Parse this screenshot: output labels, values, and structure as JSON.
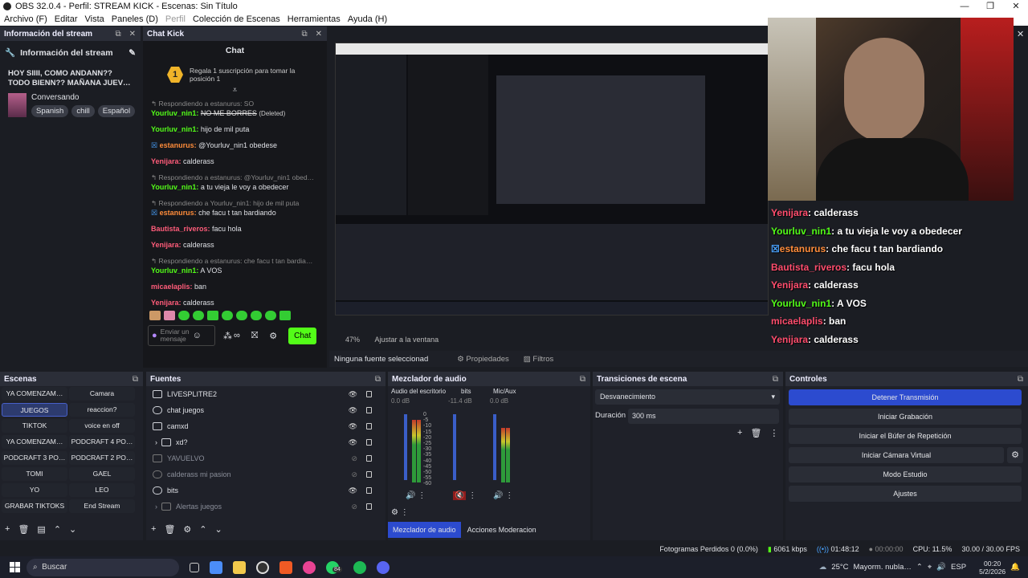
{
  "window": {
    "title": "OBS 32.0.4 - Perfil: STREAM KICK - Escenas: Sin Título"
  },
  "menu": [
    "Archivo (F)",
    "Editar",
    "Vista",
    "Paneles (D)",
    "Perfil",
    "Colección de Escenas",
    "Herramientas",
    "Ayuda (H)"
  ],
  "info_dock": {
    "header": "Información del stream",
    "title": "Información del stream",
    "stream_title": "HOY SIIII, COMO ANDANN?? TODO BIENN?? MAÑANA JUEV…",
    "category": "Conversando",
    "tags": [
      "Spanish",
      "chill",
      "Español"
    ]
  },
  "chat_dock": {
    "header": "Chat Kick",
    "title": "Chat",
    "gift_text": "Regala 1 suscripción para tomar la posición 1",
    "gift_rank": "1",
    "input_placeholder": "Enviar un mensaje",
    "send_label": "Chat",
    "messages": [
      {
        "reply": "Respondiendo a estanurus: SO"
      },
      {
        "user": "Yourluv_nin1:",
        "text": "NO ME BORRES",
        "note": "(Deleted)",
        "color": "green"
      },
      {
        "user": "Yourluv_nin1:",
        "text": "hijo de mil puta",
        "color": "green"
      },
      {
        "user": "estanurus:",
        "text": "@Yourluv_nin1 obedese",
        "color": "orange"
      },
      {
        "user": "Yenijara:",
        "text": "calderass",
        "color": "red"
      },
      {
        "reply": "Respondiendo a estanurus: @Yourluv_nin1 obed…"
      },
      {
        "user": "Yourluv_nin1:",
        "text": "a tu vieja le voy a obedecer",
        "color": "green"
      },
      {
        "reply": "Respondiendo a Yourluv_nin1: hijo de mil puta"
      },
      {
        "user": "estanurus:",
        "text": "che facu t tan bardiando",
        "color": "orange"
      },
      {
        "user": "Bautista_riveros:",
        "text": "facu hola",
        "color": "red"
      },
      {
        "user": "Yenijara:",
        "text": "calderass",
        "color": "red"
      },
      {
        "reply": "Respondiendo a estanurus: che facu t tan bardia…"
      },
      {
        "user": "Yourluv_nin1:",
        "text": "A VOS",
        "color": "green"
      },
      {
        "user": "micaelaplis:",
        "text": "ban",
        "color": "red"
      },
      {
        "user": "Yenijara:",
        "text": "calderass",
        "color": "red"
      }
    ]
  },
  "preview": {
    "zoom": "47%",
    "fit": "Ajustar a la ventana",
    "no_source": "Ninguna fuente seleccionad",
    "properties": "Propiedades",
    "filters": "Filtros"
  },
  "overlay_chat": [
    {
      "user": "Yenijara",
      "text": ": calderass",
      "color": "#ff4d6d"
    },
    {
      "user": "Yourluv_nin1",
      "text": ": a tu vieja le voy a obedecer",
      "color": "#53fc18"
    },
    {
      "user": "estanurus",
      "text": ": che facu t tan bardiando",
      "color": "#ff8c3a"
    },
    {
      "user": "Bautista_riveros",
      "text": ": facu hola",
      "color": "#ff4d6d"
    },
    {
      "user": "Yenijara",
      "text": ": calderass",
      "color": "#ff4d6d"
    },
    {
      "user": "Yourluv_nin1",
      "text": ": A VOS",
      "color": "#53fc18"
    },
    {
      "user": "micaelaplis",
      "text": ": ban",
      "color": "#ff4d6d"
    },
    {
      "user": "Yenijara",
      "text": ": calderass",
      "color": "#ff4d6d"
    }
  ],
  "scenes": {
    "header": "Escenas",
    "items": [
      "YA COMENZAM…",
      "Camara",
      "JUEGOS",
      "reaccion?",
      "TIKTOK",
      "voice en off",
      "YA COMENZAM…",
      "PODCRAFT 4 PO…",
      "PODCRAFT 3 PO…",
      "PODCRAFT 2 PO…",
      "TOMI",
      "GAEL",
      "YO",
      "LEO",
      "GRABAR TIKTOKS",
      "End Stream"
    ],
    "selected": "JUEGOS"
  },
  "sources": {
    "header": "Fuentes",
    "items": [
      {
        "name": "LIVESPLITRE2",
        "visible": true
      },
      {
        "name": "chat juegos",
        "visible": true
      },
      {
        "name": "camxd",
        "visible": true
      },
      {
        "name": "xd?",
        "visible": true,
        "group": true
      },
      {
        "name": "YAVUELVO",
        "visible": false
      },
      {
        "name": "calderass mi pasion",
        "visible": false
      },
      {
        "name": "bits",
        "visible": true
      },
      {
        "name": "Alertas juegos",
        "visible": false,
        "group": true
      }
    ]
  },
  "mixer": {
    "header": "Mezclador de audio",
    "channels": [
      {
        "name": "Audio del escritorio",
        "db": "0.0 dB"
      },
      {
        "name": "bits",
        "db": "-11.4 dB"
      },
      {
        "name": "Mic/Aux",
        "db": "0.0 dB"
      }
    ],
    "scale": [
      "0",
      "-5",
      "-10",
      "-15",
      "-20",
      "-25",
      "-30",
      "-35",
      "-40",
      "-45",
      "-50",
      "-55",
      "-60"
    ],
    "tab_active": "Mezclador de audio",
    "tab_other": "Acciones Moderacion"
  },
  "transitions": {
    "header": "Transiciones de escena",
    "selected": "Desvanecimiento",
    "duration_label": "Duración",
    "duration": "300 ms"
  },
  "controls": {
    "header": "Controles",
    "buttons": [
      "Detener Transmisión",
      "Iniciar Grabación",
      "Iniciar el Búfer de Repetición",
      "Iniciar Cámara Virtual",
      "Modo Estudio",
      "Ajustes"
    ]
  },
  "status": {
    "dropped": "Fotogramas Perdidos 0 (0.0%)",
    "bitrate": "6061 kbps",
    "stream_time": "01:48:12",
    "rec_time": "00:00:00",
    "cpu": "CPU: 11.5%",
    "fps": "30.00 / 30.00 FPS"
  },
  "taskbar": {
    "search": "Buscar",
    "weather": "25°C",
    "weather_desc": "Mayorm. nubla…",
    "lang": "ESP",
    "time": "00:20",
    "date": "5/2/2026",
    "badge": "84"
  }
}
